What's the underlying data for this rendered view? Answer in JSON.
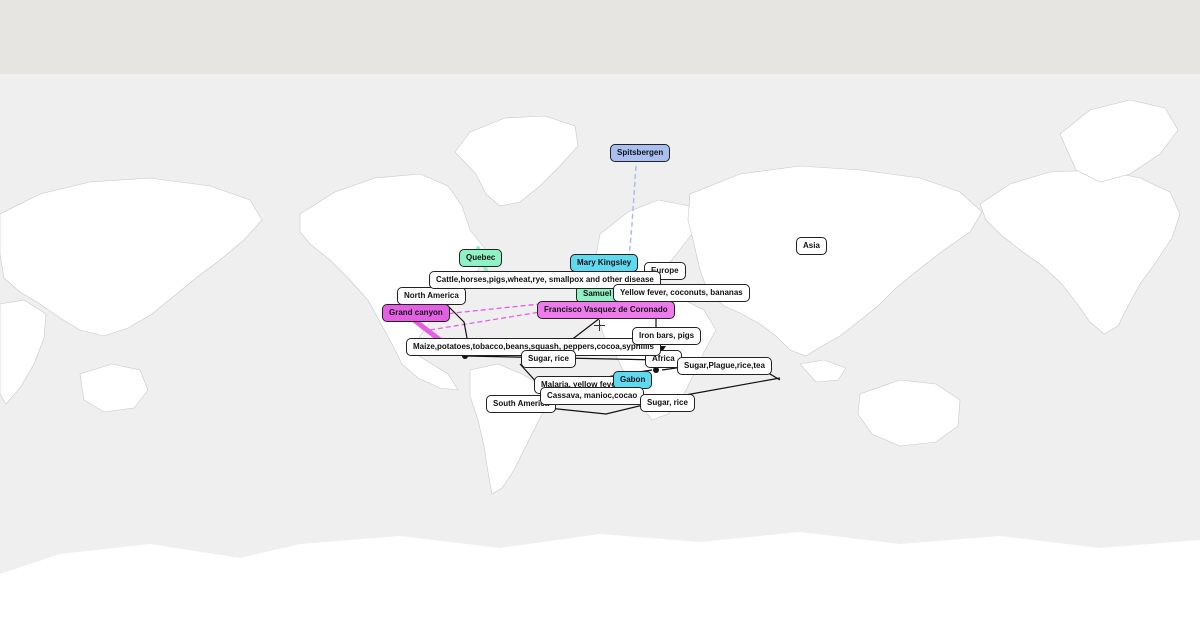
{
  "map": {
    "places": [
      {
        "id": "north-america",
        "label": "North America",
        "style": "place"
      },
      {
        "id": "south-america",
        "label": "South America",
        "style": "place"
      },
      {
        "id": "europe",
        "label": "Europe",
        "style": "place"
      },
      {
        "id": "africa",
        "label": "Africa",
        "style": "place"
      },
      {
        "id": "asia",
        "label": "Asia",
        "style": "place"
      }
    ],
    "trade_labels": [
      {
        "id": "cattle",
        "label": "Cattle,horses,pigs,wheat,rye, smallpox and other disease"
      },
      {
        "id": "yellow-fever",
        "label": "Yellow fever, coconuts, bananas"
      },
      {
        "id": "maize",
        "label": "Maize,potatoes,tobacco,beans,squash, peppers,cocoa,syphillis"
      },
      {
        "id": "sugar-rice-1",
        "label": "Sugar, rice"
      },
      {
        "id": "iron-bars",
        "label": "Iron bars, pigs"
      },
      {
        "id": "sugar-plague",
        "label": "Sugar,Plague,rice,tea"
      },
      {
        "id": "malaria",
        "label": "Malaria, yellow fever"
      },
      {
        "id": "cassava",
        "label": "Cassava, manioc,cocao"
      },
      {
        "id": "sugar-rice-2",
        "label": "Sugar, rice"
      }
    ],
    "explorer_labels": [
      {
        "id": "spitsbergen",
        "label": "Spitsbergen",
        "style": "c-blue"
      },
      {
        "id": "quebec",
        "label": "Quebec",
        "style": "c-mint"
      },
      {
        "id": "mary-kingsley",
        "label": "Mary Kingsley",
        "style": "c-cyan"
      },
      {
        "id": "samuel",
        "label": "Samuel d",
        "style": "c-mint"
      },
      {
        "id": "grand-canyon",
        "label": "Grand canyon",
        "style": "c-magenta"
      },
      {
        "id": "coronado",
        "label": "Francisco Vasquez de Coronado",
        "style": "c-pink"
      },
      {
        "id": "gabon",
        "label": "Gabon",
        "style": "c-cyan"
      }
    ],
    "colors": {
      "route": "#111111",
      "explorer_blue": "#a9bff2",
      "explorer_mint": "#8ff2c4",
      "explorer_cyan": "#5fd9f0",
      "explorer_magenta": "#e45fe4",
      "ocean": "#efefef",
      "land": "#ffffff"
    }
  }
}
